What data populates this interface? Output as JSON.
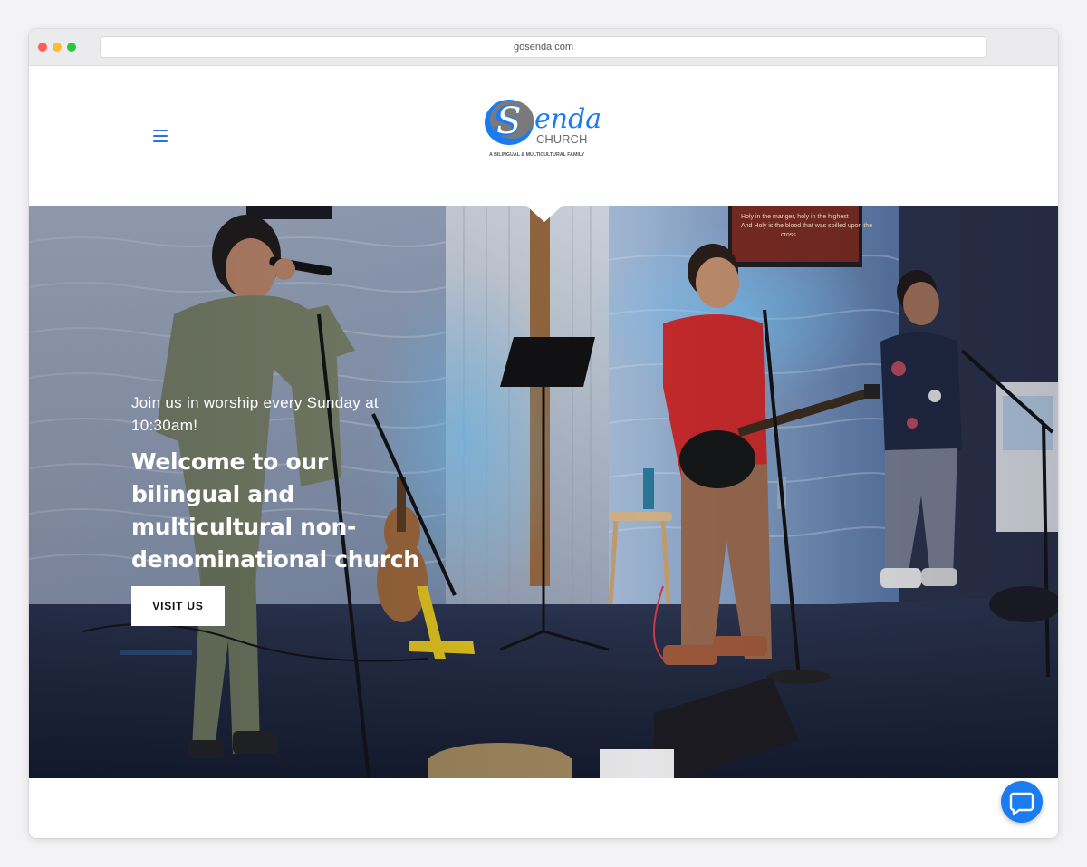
{
  "browser": {
    "url": "gosenda.com"
  },
  "header": {
    "menu_icon": "hamburger-menu-icon",
    "logo": {
      "letter": "S",
      "wordmark": "enda",
      "subtitle": "CHURCH",
      "tagline": "A BILINGUAL & MULTICULTURAL FAMILY",
      "colors": {
        "blue": "#1a7cf0",
        "gray": "#7a7a7a"
      }
    }
  },
  "hero": {
    "subtitle": "Join us in worship every Sunday at 10:30am!",
    "title": "Welcome to our bilingual and multicultural non-denominational church",
    "cta_label": "VISIT US",
    "screen_text": "Holy in the manger, holy in the highest And Holy is the blood that was spilled upon the cross"
  },
  "chat": {
    "icon": "chat-bubble-icon",
    "color": "#1a7cf0"
  },
  "colors": {
    "accent": "#2a73d9"
  }
}
